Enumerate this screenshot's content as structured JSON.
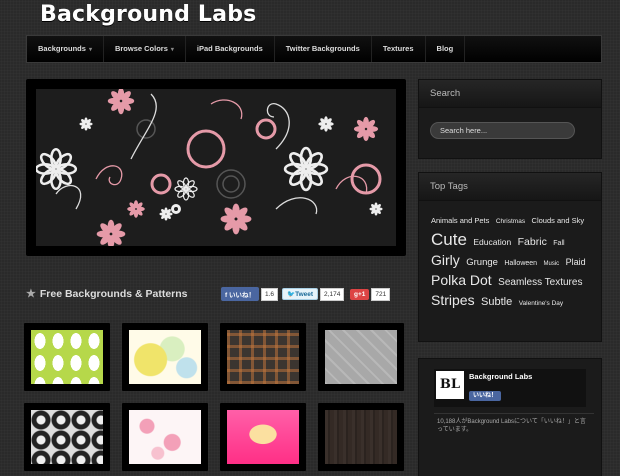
{
  "site": {
    "logo": "Background Labs"
  },
  "nav": {
    "items": [
      {
        "label": "Backgrounds",
        "dropdown": true
      },
      {
        "label": "Browse Colors",
        "dropdown": true
      },
      {
        "label": "iPad Backgrounds",
        "dropdown": false
      },
      {
        "label": "Twitter Backgrounds",
        "dropdown": false
      },
      {
        "label": "Textures",
        "dropdown": false
      },
      {
        "label": "Blog",
        "dropdown": false
      }
    ]
  },
  "main": {
    "section_title": "Free Backgrounds & Patterns",
    "share": {
      "like_label": "いいね！",
      "like_count": "1.6",
      "tweet_label": "Tweet",
      "tweet_count": "2,174",
      "gplus_label": "+1",
      "gplus_count": "721"
    }
  },
  "sidebar": {
    "search": {
      "title": "Search",
      "placeholder": "Search here..."
    },
    "tags": {
      "title": "Top Tags",
      "items": [
        {
          "label": "Animals and Pets",
          "size": 7.5
        },
        {
          "label": "Christmas",
          "size": 6.5
        },
        {
          "label": "Clouds and Sky",
          "size": 7.5
        },
        {
          "label": "Cute",
          "size": 17
        },
        {
          "label": "Education",
          "size": 8.5
        },
        {
          "label": "Fabric",
          "size": 10.5
        },
        {
          "label": "Fall",
          "size": 7
        },
        {
          "label": "Girly",
          "size": 14
        },
        {
          "label": "Grunge",
          "size": 9.5
        },
        {
          "label": "Halloween",
          "size": 7
        },
        {
          "label": "Music",
          "size": 6
        },
        {
          "label": "Plaid",
          "size": 9
        },
        {
          "label": "Polka Dot",
          "size": 14
        },
        {
          "label": "Seamless Textures",
          "size": 10
        },
        {
          "label": "Stripes",
          "size": 14
        },
        {
          "label": "Subtle",
          "size": 11
        },
        {
          "label": "Valentine's Day",
          "size": 6.5
        }
      ]
    },
    "facebook": {
      "page_name": "Background Labs",
      "logo_text": "BL",
      "like_label": "いいね！",
      "fan_text": "10,188人がBackground Labsについて「いいね！」と言っています。"
    }
  }
}
